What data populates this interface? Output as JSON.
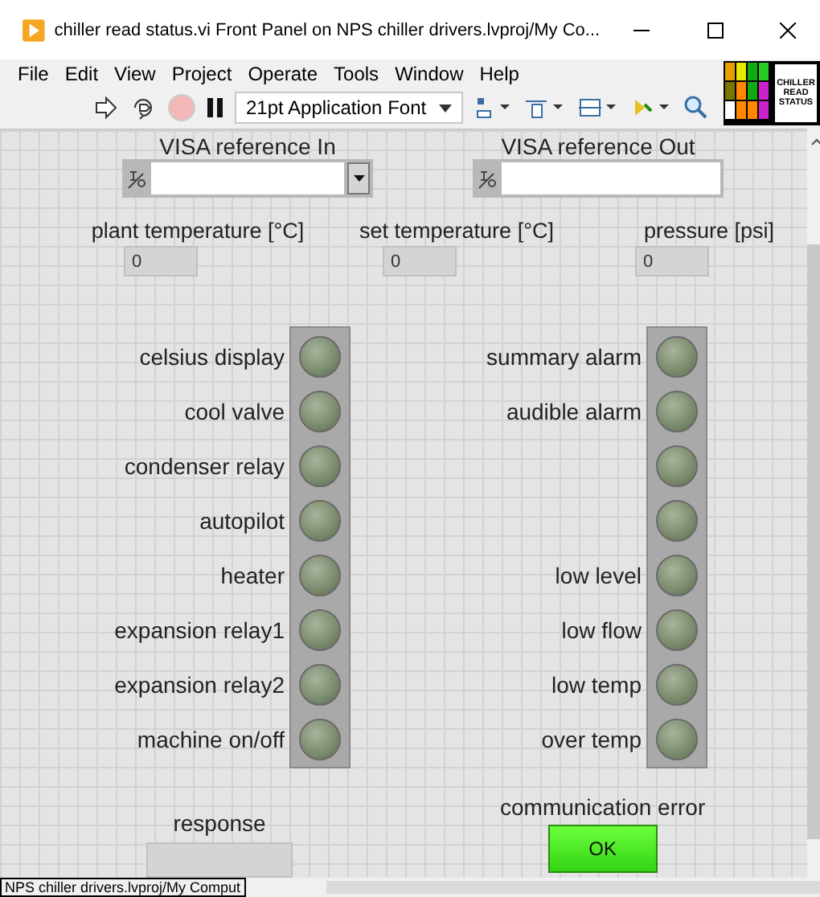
{
  "window": {
    "title": "chiller read status.vi Front Panel on NPS chiller drivers.lvproj/My Co..."
  },
  "menu": [
    "File",
    "Edit",
    "View",
    "Project",
    "Operate",
    "Tools",
    "Window",
    "Help"
  ],
  "toolbar": {
    "font": "21pt Application Font",
    "abort_disabled": true
  },
  "vi_icon": {
    "lines": [
      "CHILLER",
      "READ",
      "STATUS"
    ]
  },
  "visa": [
    {
      "label": "VISA reference In",
      "kind": "dropdown"
    },
    {
      "label": "VISA reference Out",
      "kind": "plain"
    }
  ],
  "numerics": [
    {
      "label": "plant temperature [°C]",
      "value": "0"
    },
    {
      "label": "set temperature [°C]",
      "value": "0"
    },
    {
      "label": "pressure [psi]",
      "value": "0"
    }
  ],
  "leds_left": [
    {
      "label": "celsius display",
      "on": false
    },
    {
      "label": "cool valve",
      "on": false
    },
    {
      "label": "condenser relay",
      "on": false
    },
    {
      "label": "autopilot",
      "on": false
    },
    {
      "label": "heater",
      "on": false
    },
    {
      "label": "expansion relay1",
      "on": false
    },
    {
      "label": "expansion relay2",
      "on": false
    },
    {
      "label": "machine on/off",
      "on": false
    }
  ],
  "leds_right": [
    {
      "label": "summary alarm",
      "on": false
    },
    {
      "label": "audible alarm",
      "on": false
    },
    {
      "on": false
    },
    {
      "on": false
    },
    {
      "label": "low level",
      "on": false
    },
    {
      "label": "low flow",
      "on": false
    },
    {
      "label": "low temp",
      "on": false
    },
    {
      "label": "over temp",
      "on": false
    }
  ],
  "response": {
    "label": "response"
  },
  "comm_error": {
    "label": "communication error",
    "button": "OK",
    "on": true
  },
  "status_bar": {
    "path": "NPS chiller drivers.lvproj/My Comput"
  }
}
